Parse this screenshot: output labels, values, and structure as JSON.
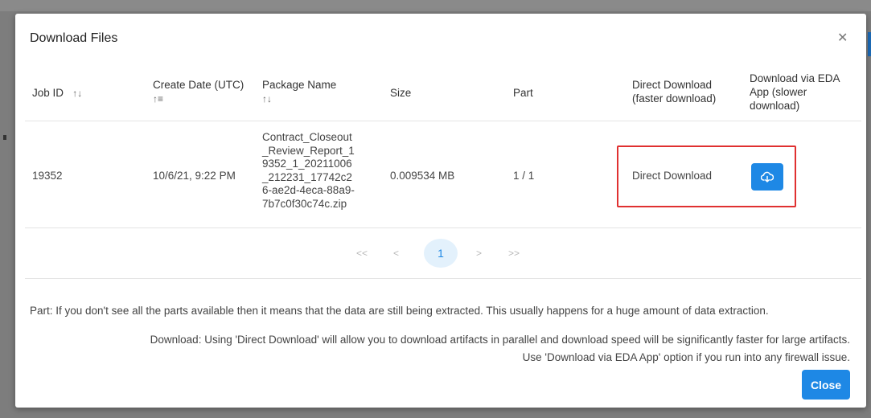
{
  "dialog": {
    "title": "Download Files",
    "close_icon": "close-icon"
  },
  "table": {
    "columns": [
      {
        "label": "Job ID",
        "sort_icon": "↑↓"
      },
      {
        "label": "Create Date (UTC)",
        "sort_icon": "↑≡"
      },
      {
        "label": "Package Name",
        "sort_icon": "↑↓"
      },
      {
        "label": "Size"
      },
      {
        "label": "Part"
      },
      {
        "label_line1": "Direct Download",
        "label_line2": "(faster download)"
      },
      {
        "label_line1": "Download via EDA",
        "label_line2": "App (slower",
        "label_line3": "download)"
      }
    ],
    "rows": [
      {
        "job_id": "19352",
        "create_date": "10/6/21, 9:22 PM",
        "package_name": "Contract_Closeout_Review_Report_19352_1_20211006_212231_17742c26-ae2d-4eca-88a9-7b7c0f30c74c.zip",
        "size": "0.009534 MB",
        "part": "1 / 1",
        "direct_download_label": "Direct Download",
        "eda_button_icon": "cloud-download-icon"
      }
    ]
  },
  "pagination": {
    "first": "<<",
    "prev": "<",
    "current": "1",
    "next": ">",
    "last": ">>"
  },
  "notes": {
    "part": "Part: If you don't see all the parts available then it means that the data are still being extracted. This usually happens for a huge amount of data extraction.",
    "download_line1": "Download: Using 'Direct Download' will allow you to download artifacts in parallel and download speed will be significantly faster for large artifacts.",
    "download_line2": "Use 'Download via EDA App' option if you run into any firewall issue."
  },
  "footer": {
    "close_label": "Close"
  },
  "colors": {
    "accent": "#1e88e5",
    "highlight": "#e03030"
  }
}
